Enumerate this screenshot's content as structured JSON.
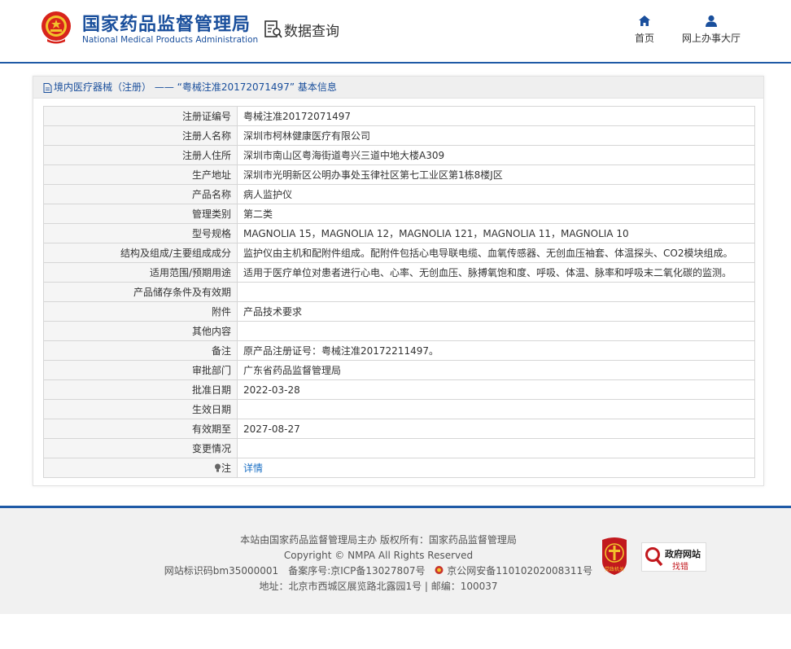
{
  "header": {
    "brand_cn": "国家药品监督管理局",
    "brand_en": "National Medical Products Administration",
    "data_query": "数据查询",
    "nav": {
      "home": "首页",
      "online_hall": "网上办事大厅"
    }
  },
  "panel": {
    "title": "境内医疗器械（注册） —— “粤械注准20172071497” 基本信息"
  },
  "rows": [
    {
      "label": "注册证编号",
      "value": "粤械注准20172071497"
    },
    {
      "label": "注册人名称",
      "value": "深圳市柯林健康医疗有限公司"
    },
    {
      "label": "注册人住所",
      "value": "深圳市南山区粤海街道粤兴三道中地大楼A309"
    },
    {
      "label": "生产地址",
      "value": "深圳市光明新区公明办事处玉律社区第七工业区第1栋8楼J区"
    },
    {
      "label": "产品名称",
      "value": "病人监护仪"
    },
    {
      "label": "管理类别",
      "value": "第二类"
    },
    {
      "label": "型号规格",
      "value": "MAGNOLIA 15，MAGNOLIA 12，MAGNOLIA 121，MAGNOLIA 11，MAGNOLIA 10"
    },
    {
      "label": "结构及组成/主要组成成分",
      "value": "监护仪由主机和配附件组成。配附件包括心电导联电缆、血氧传感器、无创血压袖套、体温探头、CO2模块组成。"
    },
    {
      "label": "适用范围/预期用途",
      "value": "适用于医疗单位对患者进行心电、心率、无创血压、脉搏氧饱和度、呼吸、体温、脉率和呼吸末二氧化碳的监测。"
    },
    {
      "label": "产品储存条件及有效期",
      "value": ""
    },
    {
      "label": "附件",
      "value": "产品技术要求"
    },
    {
      "label": "其他内容",
      "value": ""
    },
    {
      "label": "备注",
      "value": "原产品注册证号：粤械注准20172211497。"
    },
    {
      "label": "审批部门",
      "value": "广东省药品监督管理局"
    },
    {
      "label": "批准日期",
      "value": "2022-03-28"
    },
    {
      "label": "生效日期",
      "value": ""
    },
    {
      "label": "有效期至",
      "value": "2027-08-27"
    },
    {
      "label": "变更情况",
      "value": ""
    }
  ],
  "note_row": {
    "label": "注",
    "link": "详情"
  },
  "footer": {
    "line1": "本站由国家药品监督管理局主办 版权所有：国家药品监督管理局",
    "line2": "Copyright © NMPA All Rights Reserved",
    "site_id": "网站标识码bm35000001",
    "icp": "备案序号:京ICP备13027807号",
    "police": "京公网安备11010202008311号",
    "address": "地址：北京市西城区展览路北露园1号 | 邮编：100037",
    "party_badge": "党政机关",
    "gov_line1": "政府网站",
    "gov_line2": "找错"
  },
  "colors": {
    "brand_blue": "#1a4f9c",
    "link_blue": "#1a6fc4",
    "footer_bg": "#f1f1f1"
  }
}
